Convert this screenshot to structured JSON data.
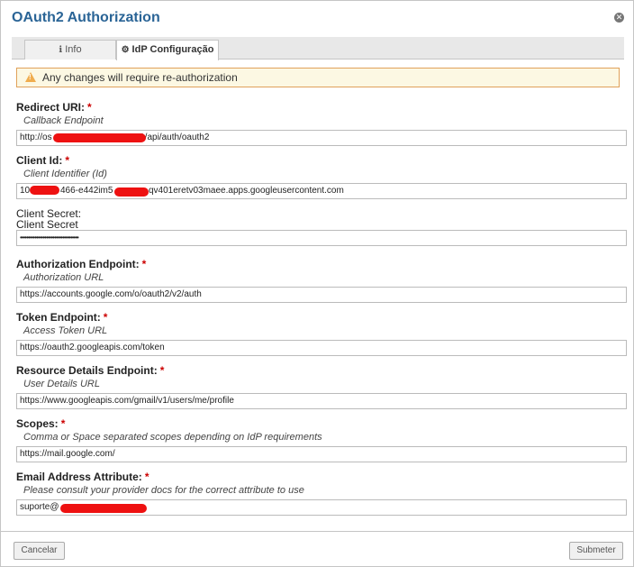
{
  "dialog": {
    "title": "OAuth2 Authorization"
  },
  "tabs": [
    {
      "label": "Info",
      "icon": "info-circle-icon"
    },
    {
      "label": "IdP Configuração",
      "icon": "gear-icon"
    }
  ],
  "warning": {
    "text": "Any changes will require re-authorization",
    "icon": "warning-triangle-icon"
  },
  "fields": {
    "redirect_uri": {
      "label": "Redirect URI:",
      "required": "*",
      "hint": "Callback Endpoint",
      "value_start": "http://os",
      "value_end": "821/api/auth/oauth2"
    },
    "client_id": {
      "label": "Client Id:",
      "required": "*",
      "hint": "Client Identifier (Id)",
      "value_start": "10",
      "value_mid": "466-e442im5",
      "value_end": "qv401eretv03maee.apps.googleusercontent.com"
    },
    "client_secret": {
      "label1": "Client Secret:",
      "label2": "Client Secret",
      "value": "••••••••••••••••••••••••••••••••••••"
    },
    "authorization_endpoint": {
      "label": "Authorization Endpoint:",
      "required": "*",
      "hint": "Authorization URL",
      "value": "https://accounts.google.com/o/oauth2/v2/auth"
    },
    "token_endpoint": {
      "label": "Token Endpoint:",
      "required": "*",
      "hint": "Access Token URL",
      "value": "https://oauth2.googleapis.com/token"
    },
    "resource_details_endpoint": {
      "label": "Resource Details Endpoint:",
      "required": "*",
      "hint": "User Details URL",
      "value": "https://www.googleapis.com/gmail/v1/users/me/profile"
    },
    "scopes": {
      "label": "Scopes:",
      "required": "*",
      "hint": "Comma or Space separated scopes depending on IdP requirements",
      "value": "https://mail.google.com/"
    },
    "email_attribute": {
      "label": "Email Address Attribute:",
      "required": "*",
      "hint": "Please consult your provider docs for the correct attribute to use",
      "value_start": "suporte@"
    }
  },
  "footer": {
    "cancel_label": "Cancelar",
    "submit_label": "Submeter"
  },
  "colors": {
    "title": "#2a6496",
    "required": "#cc0000",
    "warning_bg": "#fcf8e3",
    "warning_border": "#e0a15a",
    "redaction": "#ee1111"
  }
}
